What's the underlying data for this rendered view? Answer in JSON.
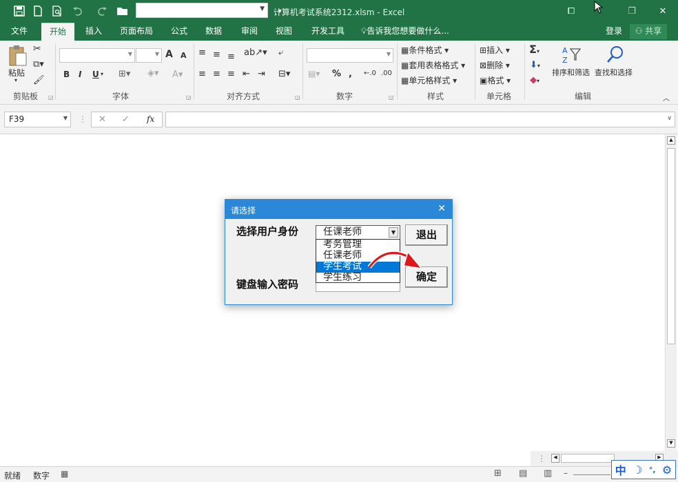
{
  "window": {
    "title": "计算机考试系统2312.xlsm  -  Excel",
    "controls": {
      "ribbon_opt": "⧠",
      "minimize": "—",
      "restore": "❐",
      "close": "✕"
    }
  },
  "quick_access": {
    "save": "save-icon",
    "new": "new-file-icon",
    "print_preview": "print-preview-icon",
    "undo": "undo-icon",
    "redo": "redo-icon",
    "open": "open-folder-icon",
    "customize": "▾"
  },
  "tabs": [
    "文件",
    "开始",
    "插入",
    "页面布局",
    "公式",
    "数据",
    "审阅",
    "视图",
    "开发工具"
  ],
  "active_tab": "开始",
  "tell_me": "告诉我您想要做什么...",
  "account": {
    "login": "登录",
    "share": "共享"
  },
  "ribbon": {
    "clipboard": {
      "label": "剪贴板",
      "paste": "粘贴"
    },
    "font": {
      "label": "字体",
      "bold": "B",
      "italic": "I",
      "underline": "U",
      "grow": "A",
      "shrink": "A"
    },
    "alignment": {
      "label": "对齐方式"
    },
    "number": {
      "label": "数字",
      "percent": "%",
      "comma": ","
    },
    "styles": {
      "label": "样式",
      "conditional": "条件格式",
      "table": "套用表格格式",
      "cell": "单元格样式"
    },
    "cells": {
      "label": "单元格",
      "insert": "插入",
      "delete": "删除",
      "format": "格式"
    },
    "editing": {
      "label": "编辑",
      "sort": "排序和筛选",
      "find": "查找和选择"
    }
  },
  "formula_bar": {
    "name_box": "F39",
    "fx": "fx",
    "formula": ""
  },
  "dialog": {
    "title": "请选择",
    "close": "✕",
    "identity_label": "选择用户身份",
    "password_label": "键盘输入密码",
    "selected": "任课老师",
    "options": [
      "考务管理",
      "任课老师",
      "学生考试",
      "学生练习"
    ],
    "highlighted_index": 2,
    "exit_button": "退出",
    "ok_button": "确定",
    "accent": "#2b87d7"
  },
  "status": {
    "ready": "就绪",
    "mode": "数字"
  },
  "ime": {
    "lang": "中",
    "moon": "☽",
    "punct": "°,",
    "settings": "⚙"
  },
  "colors": {
    "excel_green": "#217346",
    "highlight": "#0078d7",
    "arrow_red": "#e0161b"
  }
}
